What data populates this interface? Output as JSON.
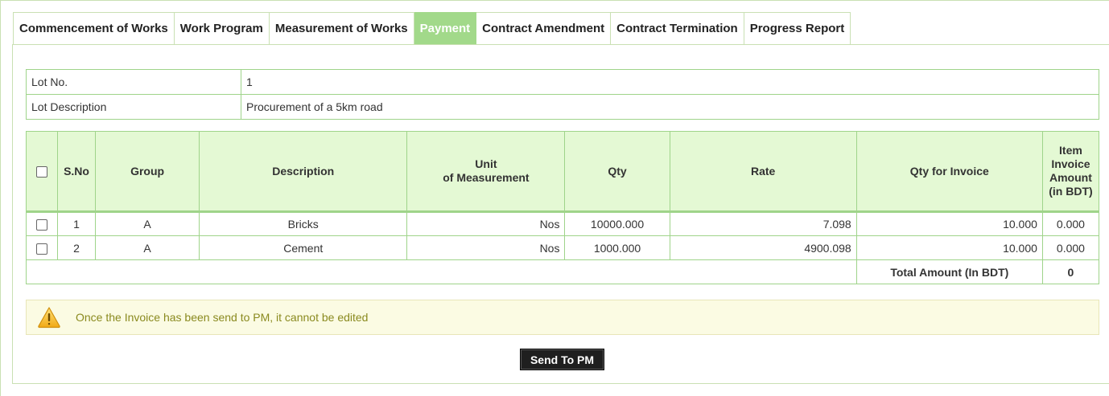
{
  "tabs": [
    {
      "label": "Commencement of Works"
    },
    {
      "label": "Work Program"
    },
    {
      "label": "Measurement of Works"
    },
    {
      "label": "Payment"
    },
    {
      "label": "Contract Amendment"
    },
    {
      "label": "Contract Termination"
    },
    {
      "label": "Progress Report"
    }
  ],
  "active_tab": "Payment",
  "lot": {
    "no_label": "Lot No.",
    "no_value": "1",
    "desc_label": "Lot Description",
    "desc_value": "Procurement of a 5km road"
  },
  "table": {
    "headers": {
      "sno": "S.No",
      "group": "Group",
      "description": "Description",
      "unit_line1": "Unit",
      "unit_line2": "of Measurement",
      "qty": "Qty",
      "rate": "Rate",
      "qty_invoice": "Qty for Invoice",
      "amount": "Item Invoice Amount (in BDT)"
    },
    "rows": [
      {
        "sno": "1",
        "group": "A",
        "description": "Bricks",
        "unit": "Nos",
        "qty": "10000.000",
        "rate": "7.098",
        "qty_invoice": "10.000",
        "amount": "0.000"
      },
      {
        "sno": "2",
        "group": "A",
        "description": "Cement",
        "unit": "Nos",
        "qty": "1000.000",
        "rate": "4900.098",
        "qty_invoice": "10.000",
        "amount": "0.000"
      }
    ],
    "total_label": "Total Amount (In BDT)",
    "total_value": "0"
  },
  "notice": {
    "icon": "warning-icon",
    "text": "Once the Invoice has been send to PM, it cannot be edited"
  },
  "send_button": "Send To PM",
  "colors": {
    "active_tab_bg": "#a2d98a",
    "border": "#9fd48a",
    "header_bg": "#e4f9d4",
    "notice_bg": "#fbfbe3",
    "notice_text": "#8a8a1f",
    "button_bg": "#1f1f1f"
  }
}
